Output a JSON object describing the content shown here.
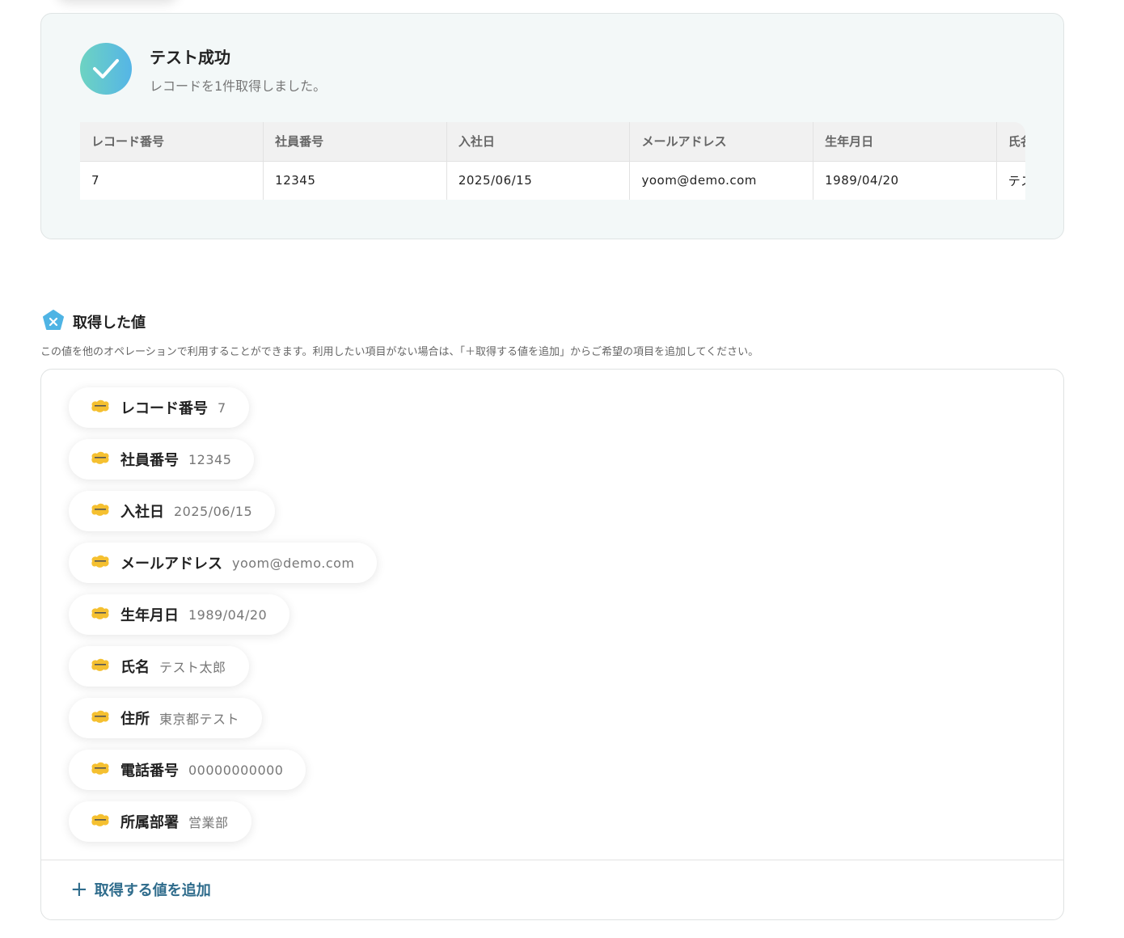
{
  "result": {
    "title": "テスト成功",
    "subtitle": "レコードを1件取得しました。",
    "columns": [
      "レコード番号",
      "社員番号",
      "入社日",
      "メールアドレス",
      "生年月日",
      "氏名"
    ],
    "row": [
      "7",
      "12345",
      "2025/06/15",
      "yoom@demo.com",
      "1989/04/20",
      "テスト太郎"
    ]
  },
  "section": {
    "title": "取得した値",
    "description": "この値を他のオペレーションで利用することができます。利用したい項目がない場合は、「＋取得する値を追加」からご希望の項目を追加してください。"
  },
  "values": [
    {
      "key": "レコード番号",
      "value": "7"
    },
    {
      "key": "社員番号",
      "value": "12345"
    },
    {
      "key": "入社日",
      "value": "2025/06/15"
    },
    {
      "key": "メールアドレス",
      "value": "yoom@demo.com"
    },
    {
      "key": "生年月日",
      "value": "1989/04/20"
    },
    {
      "key": "氏名",
      "value": "テスト太郎"
    },
    {
      "key": "住所",
      "value": "東京都テスト"
    },
    {
      "key": "電話番号",
      "value": "00000000000"
    },
    {
      "key": "所属部署",
      "value": "営業部"
    }
  ],
  "add_label": "取得する値を追加",
  "colors": {
    "accent": "#2f6c8c",
    "kintone": "#f5c030"
  }
}
